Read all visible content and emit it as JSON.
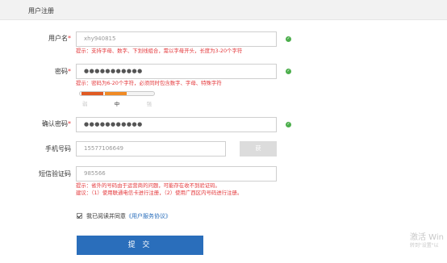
{
  "header": {
    "title": "用户注册"
  },
  "form": {
    "username": {
      "label": "用户名",
      "required_mark": "*",
      "value": "xhy940815",
      "hint": "提示：支持字母、数字、下划线组合，需以字母开头，长度为3-20个字符"
    },
    "password": {
      "label": "密码",
      "required_mark": "*",
      "value": "●●●●●●●●●●●",
      "hint": "提示：密码为6-20个字符，必须同时包含数字、字母、特殊字符",
      "strength_labels": [
        "弱",
        "中",
        "强"
      ],
      "strength_level": 2
    },
    "confirm_password": {
      "label": "确认密码",
      "required_mark": "*",
      "value": "●●●●●●●●●●●"
    },
    "phone": {
      "label": "手机号码",
      "value": "15577106649",
      "button_label": "获"
    },
    "sms_code": {
      "label": "短信验证码",
      "value": "985566",
      "hint_line1": "提示：省外的号码由于运营商的问题，可能存在收不到验证码。",
      "hint_line2": "建议：（1）使用联通电信卡进行注册，（2）使用广西区内号码进行注册。"
    },
    "agree": {
      "text": "我已阅读并同意",
      "link": "《用户服务协议》",
      "checked": true
    },
    "submit_label": "提 交"
  },
  "watermark": {
    "line1": "激活 Win",
    "line2": "转到\"设置\"以"
  },
  "colors": {
    "accent": "#2a6ebb",
    "error": "#e4393c",
    "ok": "#4cae4c"
  },
  "icons": {
    "valid": "check-circle-icon"
  }
}
